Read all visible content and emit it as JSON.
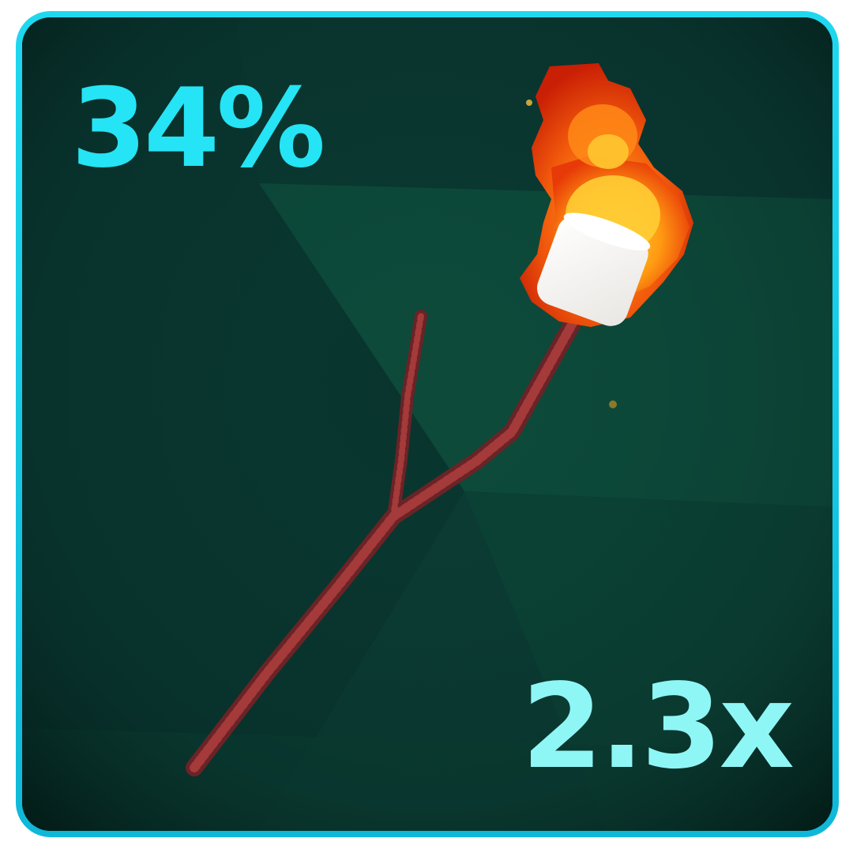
{
  "item_card": {
    "percent_label": "34%",
    "multiplier_label": "2.3x",
    "item_icon": "marshmallow-stick-icon",
    "colors": {
      "border": "#1fd8f0",
      "background": "#0a3b34",
      "percent_text": "#25e4f5",
      "multiplier_text": "#8ff6f6"
    }
  }
}
